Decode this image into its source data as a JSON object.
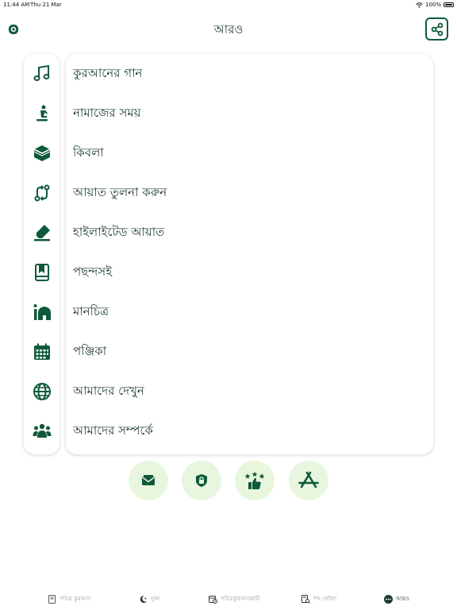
{
  "status": {
    "time": "11:44 AM",
    "date": "Thu 21 Mar",
    "battery": "100%"
  },
  "header": {
    "title": "আরও"
  },
  "menu": [
    {
      "label": "কুরআনের গান",
      "icon": "music-note-icon"
    },
    {
      "label": "নামাজের সময়",
      "icon": "prayer-icon"
    },
    {
      "label": "কিবলা",
      "icon": "kaaba-icon"
    },
    {
      "label": "আয়াত তুলনা করুন",
      "icon": "compare-arrows-icon"
    },
    {
      "label": "হাইলাইটেড আয়াত",
      "icon": "highlighter-icon"
    },
    {
      "label": "পছন্দসই",
      "icon": "bookmark-book-icon"
    },
    {
      "label": "মানচিত্র",
      "icon": "mosque-map-icon"
    },
    {
      "label": "পঞ্জিকা",
      "icon": "calendar-icon"
    },
    {
      "label": "আমাদের দেখুন",
      "icon": "globe-icon"
    },
    {
      "label": "আমাদের সম্পর্কে",
      "icon": "people-icon"
    }
  ],
  "actions": [
    {
      "name": "mail-icon"
    },
    {
      "name": "privacy-lock-icon"
    },
    {
      "name": "rate-thumbs-up-icon"
    },
    {
      "name": "app-store-icon"
    }
  ],
  "tabs": [
    {
      "label": "পবিত্র কুরআন",
      "icon": "quran-book-icon",
      "active": false
    },
    {
      "label": "দুআ",
      "icon": "crescent-star-icon",
      "active": false
    },
    {
      "label": "পবিত্রকুরআনকারী",
      "icon": "calendar-clock-icon",
      "active": false
    },
    {
      "label": "শব্দ খোঁজা",
      "icon": "search-book-icon",
      "active": false
    },
    {
      "label": "আরও",
      "icon": "more-dots-icon",
      "active": true
    }
  ],
  "colors": {
    "accent": "#0f5a3a",
    "action_bg": "#e7f6dd",
    "text": "#1b3b2c",
    "tab_inactive": "#9aa39e"
  }
}
